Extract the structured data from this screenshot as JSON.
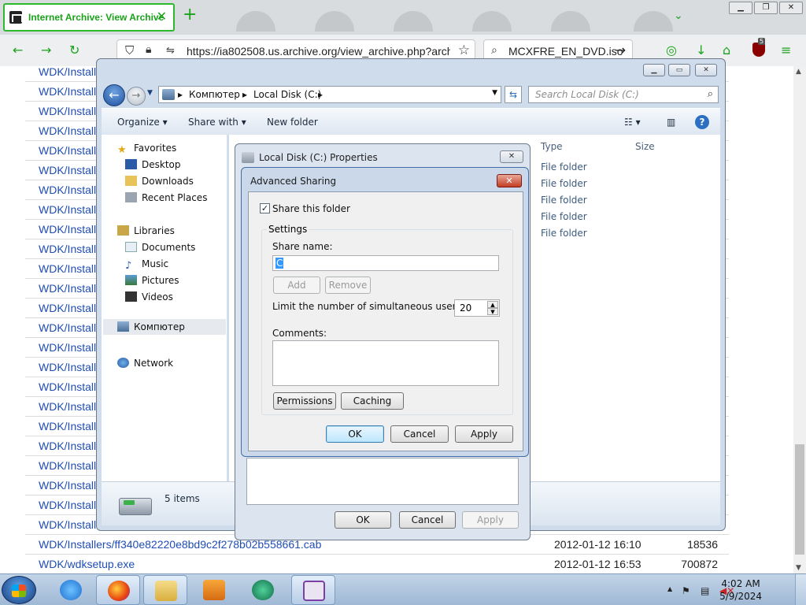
{
  "browser": {
    "tab_title": "Internet Archive: View Archive",
    "tab_close": "✕",
    "new_tab": "+",
    "tab_list": "⌄",
    "url": "https://ia802508.us.archive.org/view_archive.php?archi",
    "search_query": "MCXFRE_EN_DVD.iso",
    "ublock_badge": "5",
    "accent_color": "#1aa31a"
  },
  "page": {
    "rows": [
      {
        "name": "WDK/Install"
      },
      {
        "name": "WDK/Install"
      },
      {
        "name": "WDK/Install"
      },
      {
        "name": "WDK/Install"
      },
      {
        "name": "WDK/Install"
      },
      {
        "name": "WDK/Install"
      },
      {
        "name": "WDK/Install"
      },
      {
        "name": "WDK/Install"
      },
      {
        "name": "WDK/Install"
      },
      {
        "name": "WDK/Install"
      },
      {
        "name": "WDK/Install"
      },
      {
        "name": "WDK/Install"
      },
      {
        "name": "WDK/Install"
      },
      {
        "name": "WDK/Install"
      },
      {
        "name": "WDK/Install"
      },
      {
        "name": "WDK/Install"
      },
      {
        "name": "WDK/Install"
      },
      {
        "name": "WDK/Install"
      },
      {
        "name": "WDK/Install"
      },
      {
        "name": "WDK/Install"
      },
      {
        "name": "WDK/Install"
      },
      {
        "name": "WDK/Install"
      },
      {
        "name": "WDK/Install"
      },
      {
        "name": "WDK/Install"
      },
      {
        "name": "WDK/Installers/ff340e82220e8bd9c2f278b02b558661.cab",
        "date": "2012-01-12 16:10",
        "size": "18536"
      },
      {
        "name": "WDK/wdksetup.exe",
        "date": "2012-01-12 16:53",
        "size": "700872"
      }
    ]
  },
  "explorer": {
    "breadcrumb_computer": "Компютер",
    "breadcrumb_disk": "Local Disk (C:)",
    "search_placeholder": "Search Local Disk (C:)",
    "cmd_organize": "Organize",
    "cmd_share": "Share with",
    "cmd_newfolder": "New folder",
    "nav": {
      "favorites": "Favorites",
      "desktop": "Desktop",
      "downloads": "Downloads",
      "recent": "Recent Places",
      "libraries": "Libraries",
      "documents": "Documents",
      "music": "Music",
      "pictures": "Pictures",
      "videos": "Videos",
      "computer": "Компютер",
      "network": "Network"
    },
    "col_type": "Type",
    "col_size": "Size",
    "file_types": [
      "File folder",
      "File folder",
      "File folder",
      "File folder",
      "File folder"
    ],
    "items_count": "5 items"
  },
  "properties": {
    "title": "Local Disk (C:) Properties",
    "ok": "OK",
    "cancel": "Cancel",
    "apply": "Apply"
  },
  "advanced": {
    "title": "Advanced Sharing",
    "share_checkbox": "Share this folder",
    "share_checked": true,
    "settings_legend": "Settings",
    "share_name_label": "Share name:",
    "share_name_value": "C",
    "add": "Add",
    "remove": "Remove",
    "limit_label": "Limit the number of simultaneous users to:",
    "limit_value": "20",
    "comments_label": "Comments:",
    "permissions": "Permissions",
    "caching": "Caching",
    "ok": "OK",
    "cancel": "Cancel",
    "apply": "Apply"
  },
  "taskbar": {
    "time": "4:02 AM",
    "date": "5/9/2024"
  }
}
